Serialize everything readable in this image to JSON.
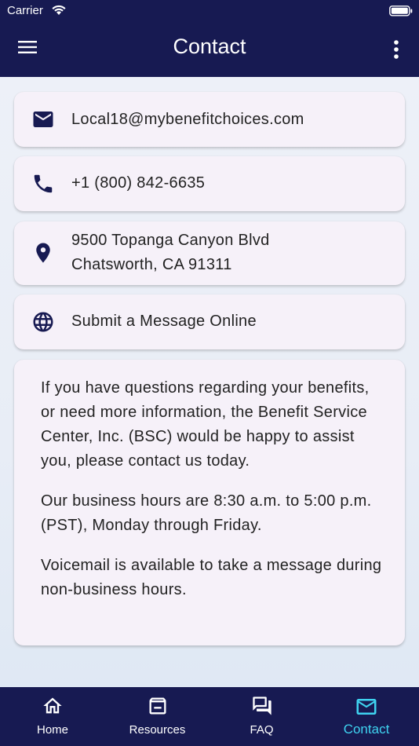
{
  "status_bar": {
    "carrier": "Carrier"
  },
  "app_bar": {
    "title": "Contact"
  },
  "contact_rows": {
    "email": "Local18@mybenefitchoices.com",
    "phone": "+1 (800) 842-6635",
    "address_line1": "9500 Topanga Canyon Blvd",
    "address_line2": "Chatsworth, CA 91311",
    "web": "Submit a Message Online"
  },
  "info": {
    "paragraph1": "If you have questions regarding your benefits, or need more information, the Benefit Service Center, Inc. (BSC) would be happy to assist you, please contact us today.",
    "paragraph2": "Our business hours are 8:30 a.m. to 5:00 p.m. (PST), Monday through Friday.",
    "paragraph3": "Voicemail is available to take a message during non-business hours."
  },
  "tabs": [
    {
      "label": "Home",
      "icon": "home-icon"
    },
    {
      "label": "Resources",
      "icon": "archive-icon"
    },
    {
      "label": "FAQ",
      "icon": "forum-icon"
    },
    {
      "label": "Contact",
      "icon": "mail-icon",
      "active": true
    }
  ],
  "colors": {
    "navy": "#171a52",
    "active_tab": "#3fd3f0",
    "card_bg": "#f6f1f9"
  }
}
